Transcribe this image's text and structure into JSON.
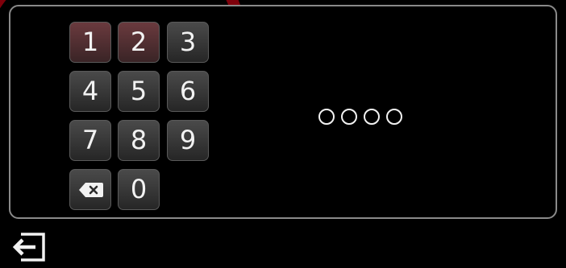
{
  "keypad": {
    "keys": [
      "1",
      "2",
      "3",
      "4",
      "5",
      "6",
      "7",
      "8",
      "9",
      "0"
    ],
    "backspace_icon": "backspace-icon"
  },
  "pin": {
    "length": 4,
    "entered": 0
  },
  "footer": {
    "exit_icon": "exit-icon"
  },
  "colors": {
    "background": "#000000",
    "panel_border": "#8a8a8a",
    "watermark": "#e60014"
  }
}
